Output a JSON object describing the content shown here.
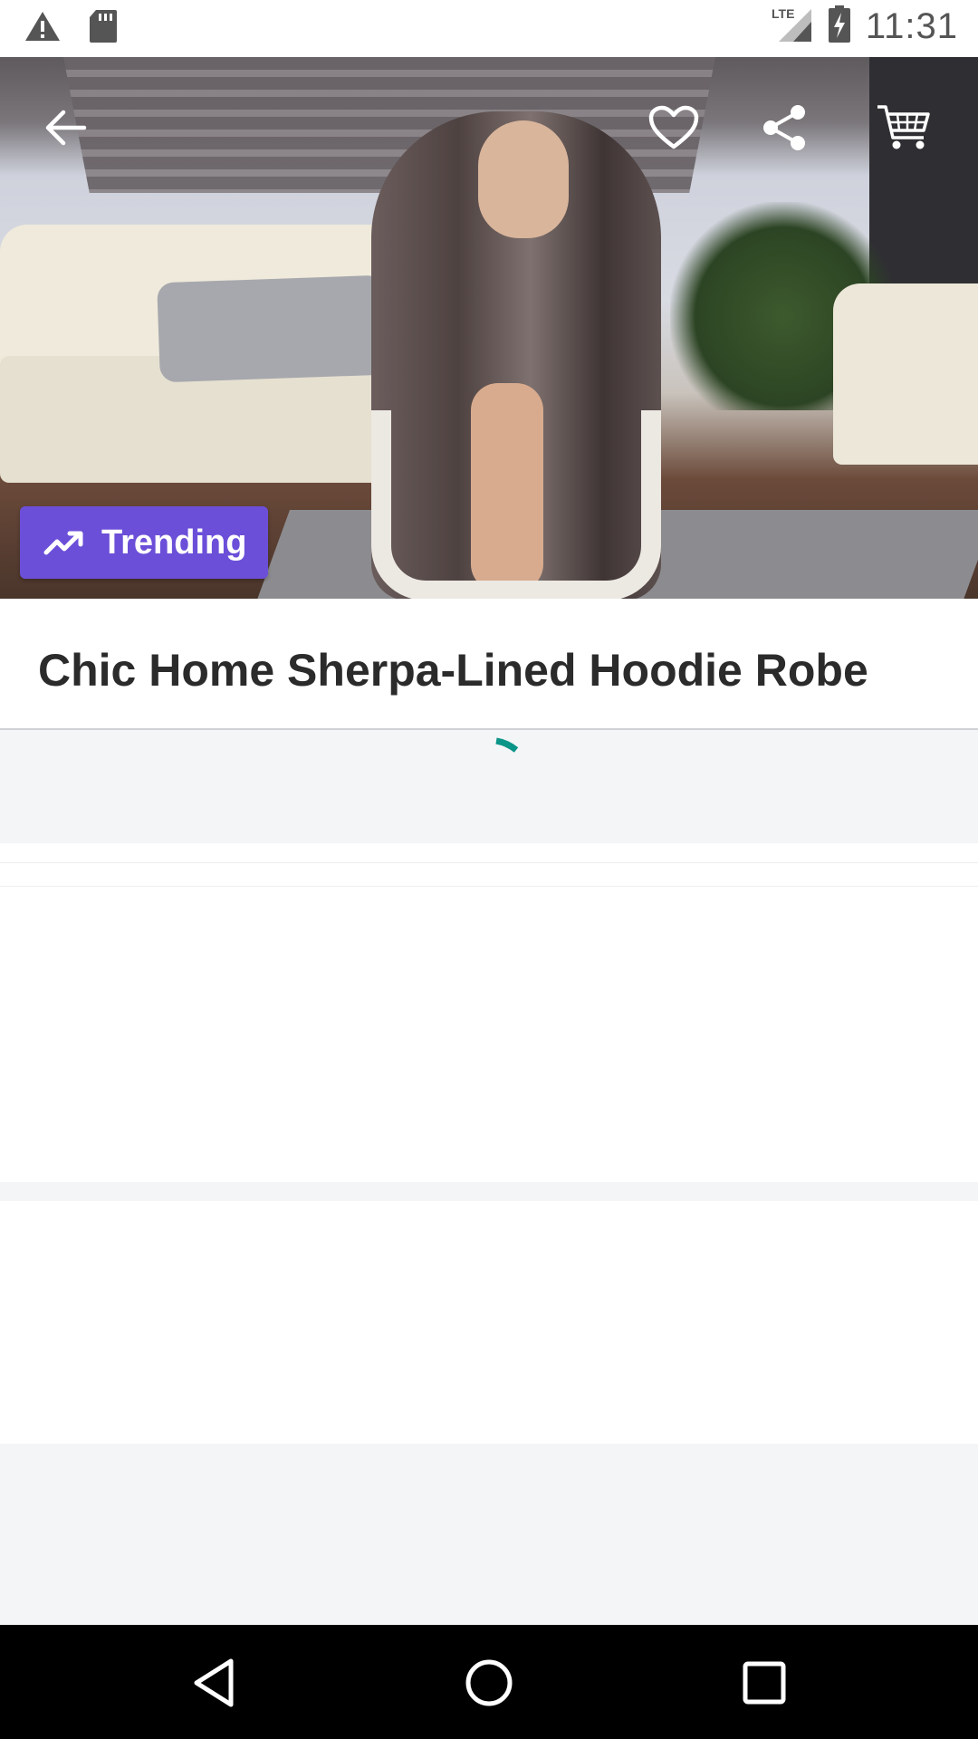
{
  "status_bar": {
    "time": "11:31",
    "network": "LTE",
    "icons": [
      "alert-icon",
      "sd-card-icon",
      "signal-icon",
      "battery-charging-icon"
    ]
  },
  "hero": {
    "icons": [
      "back-arrow-icon",
      "heart-icon",
      "share-icon",
      "cart-icon"
    ],
    "badge": {
      "label": "Trending",
      "icon": "trending-up-icon",
      "color": "#6b4fd8"
    }
  },
  "product": {
    "title": "Chic Home Sherpa-Lined Hoodie Robe"
  },
  "loading": {
    "spinner_color": "#0b9488"
  },
  "nav_bar": {
    "icons": [
      "back-triangle-icon",
      "home-circle-icon",
      "recents-square-icon"
    ]
  }
}
